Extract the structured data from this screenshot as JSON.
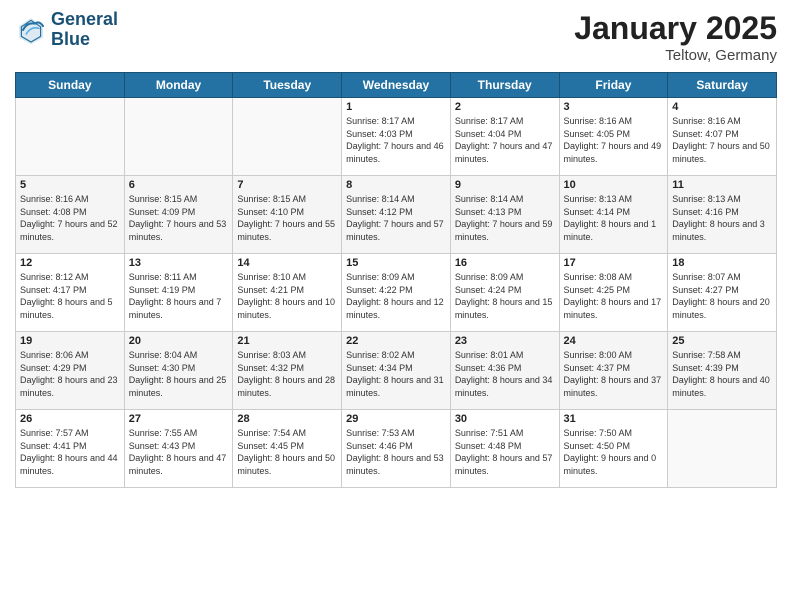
{
  "header": {
    "logo_line1": "General",
    "logo_line2": "Blue",
    "month_title": "January 2025",
    "location": "Teltow, Germany"
  },
  "days_of_week": [
    "Sunday",
    "Monday",
    "Tuesday",
    "Wednesday",
    "Thursday",
    "Friday",
    "Saturday"
  ],
  "weeks": [
    [
      {
        "day": "",
        "info": ""
      },
      {
        "day": "",
        "info": ""
      },
      {
        "day": "",
        "info": ""
      },
      {
        "day": "1",
        "info": "Sunrise: 8:17 AM\nSunset: 4:03 PM\nDaylight: 7 hours and 46 minutes."
      },
      {
        "day": "2",
        "info": "Sunrise: 8:17 AM\nSunset: 4:04 PM\nDaylight: 7 hours and 47 minutes."
      },
      {
        "day": "3",
        "info": "Sunrise: 8:16 AM\nSunset: 4:05 PM\nDaylight: 7 hours and 49 minutes."
      },
      {
        "day": "4",
        "info": "Sunrise: 8:16 AM\nSunset: 4:07 PM\nDaylight: 7 hours and 50 minutes."
      }
    ],
    [
      {
        "day": "5",
        "info": "Sunrise: 8:16 AM\nSunset: 4:08 PM\nDaylight: 7 hours and 52 minutes."
      },
      {
        "day": "6",
        "info": "Sunrise: 8:15 AM\nSunset: 4:09 PM\nDaylight: 7 hours and 53 minutes."
      },
      {
        "day": "7",
        "info": "Sunrise: 8:15 AM\nSunset: 4:10 PM\nDaylight: 7 hours and 55 minutes."
      },
      {
        "day": "8",
        "info": "Sunrise: 8:14 AM\nSunset: 4:12 PM\nDaylight: 7 hours and 57 minutes."
      },
      {
        "day": "9",
        "info": "Sunrise: 8:14 AM\nSunset: 4:13 PM\nDaylight: 7 hours and 59 minutes."
      },
      {
        "day": "10",
        "info": "Sunrise: 8:13 AM\nSunset: 4:14 PM\nDaylight: 8 hours and 1 minute."
      },
      {
        "day": "11",
        "info": "Sunrise: 8:13 AM\nSunset: 4:16 PM\nDaylight: 8 hours and 3 minutes."
      }
    ],
    [
      {
        "day": "12",
        "info": "Sunrise: 8:12 AM\nSunset: 4:17 PM\nDaylight: 8 hours and 5 minutes."
      },
      {
        "day": "13",
        "info": "Sunrise: 8:11 AM\nSunset: 4:19 PM\nDaylight: 8 hours and 7 minutes."
      },
      {
        "day": "14",
        "info": "Sunrise: 8:10 AM\nSunset: 4:21 PM\nDaylight: 8 hours and 10 minutes."
      },
      {
        "day": "15",
        "info": "Sunrise: 8:09 AM\nSunset: 4:22 PM\nDaylight: 8 hours and 12 minutes."
      },
      {
        "day": "16",
        "info": "Sunrise: 8:09 AM\nSunset: 4:24 PM\nDaylight: 8 hours and 15 minutes."
      },
      {
        "day": "17",
        "info": "Sunrise: 8:08 AM\nSunset: 4:25 PM\nDaylight: 8 hours and 17 minutes."
      },
      {
        "day": "18",
        "info": "Sunrise: 8:07 AM\nSunset: 4:27 PM\nDaylight: 8 hours and 20 minutes."
      }
    ],
    [
      {
        "day": "19",
        "info": "Sunrise: 8:06 AM\nSunset: 4:29 PM\nDaylight: 8 hours and 23 minutes."
      },
      {
        "day": "20",
        "info": "Sunrise: 8:04 AM\nSunset: 4:30 PM\nDaylight: 8 hours and 25 minutes."
      },
      {
        "day": "21",
        "info": "Sunrise: 8:03 AM\nSunset: 4:32 PM\nDaylight: 8 hours and 28 minutes."
      },
      {
        "day": "22",
        "info": "Sunrise: 8:02 AM\nSunset: 4:34 PM\nDaylight: 8 hours and 31 minutes."
      },
      {
        "day": "23",
        "info": "Sunrise: 8:01 AM\nSunset: 4:36 PM\nDaylight: 8 hours and 34 minutes."
      },
      {
        "day": "24",
        "info": "Sunrise: 8:00 AM\nSunset: 4:37 PM\nDaylight: 8 hours and 37 minutes."
      },
      {
        "day": "25",
        "info": "Sunrise: 7:58 AM\nSunset: 4:39 PM\nDaylight: 8 hours and 40 minutes."
      }
    ],
    [
      {
        "day": "26",
        "info": "Sunrise: 7:57 AM\nSunset: 4:41 PM\nDaylight: 8 hours and 44 minutes."
      },
      {
        "day": "27",
        "info": "Sunrise: 7:55 AM\nSunset: 4:43 PM\nDaylight: 8 hours and 47 minutes."
      },
      {
        "day": "28",
        "info": "Sunrise: 7:54 AM\nSunset: 4:45 PM\nDaylight: 8 hours and 50 minutes."
      },
      {
        "day": "29",
        "info": "Sunrise: 7:53 AM\nSunset: 4:46 PM\nDaylight: 8 hours and 53 minutes."
      },
      {
        "day": "30",
        "info": "Sunrise: 7:51 AM\nSunset: 4:48 PM\nDaylight: 8 hours and 57 minutes."
      },
      {
        "day": "31",
        "info": "Sunrise: 7:50 AM\nSunset: 4:50 PM\nDaylight: 9 hours and 0 minutes."
      },
      {
        "day": "",
        "info": ""
      }
    ]
  ]
}
